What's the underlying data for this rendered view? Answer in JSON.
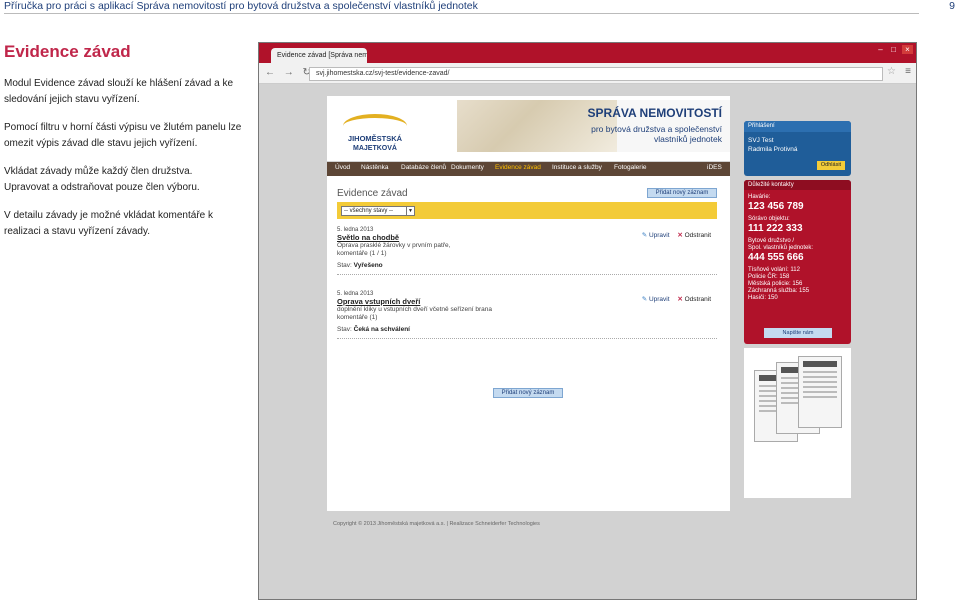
{
  "doc_header": {
    "title": "Příručka pro práci s aplikací Správa nemovitostí pro bytová družstva a společenství vlastníků jednotek",
    "page_number": "9"
  },
  "left": {
    "heading": "Evidence závad",
    "p1": "Modul Evidence závad slouží ke hlášení závad a ke sledování jejich stavu vyřízení.",
    "p2": "Pomocí filtru v horní části výpisu ve žlutém panelu lze omezit výpis závad dle stavu jejich vyřízení.",
    "p3a": "Vkládat závady může každý člen družstva.",
    "p3b": "Upravovat a odstraňovat pouze člen výboru.",
    "p4": "V detailu závady je možné vkládat komentáře k realizaci a stavu vyřízení závady."
  },
  "browser": {
    "tab_title": "Evidence závad [Správa nem",
    "url": "svj.jihomestska.cz/svj-test/evidence-zavad/"
  },
  "site": {
    "logo_line1": "JIHOMĚSTSKÁ",
    "logo_line2": "MAJETKOVÁ",
    "banner_title": "SPRÁVA NEMOVITOSTÍ",
    "banner_line2": "pro bytová družstva a společenství",
    "banner_line3": "vlastníků jednotek",
    "nav": [
      "Úvod",
      "Nástěnka",
      "Databáze členů",
      "Dokumenty",
      "Evidence závad",
      "Instituce a služby",
      "Fotogalerie",
      "iDES"
    ],
    "page_title": "Evidence závad",
    "add_new_label": "Přidat nový záznam",
    "filter_value": "-- všechny stavy --",
    "items": [
      {
        "date": "5. ledna 2013",
        "title": "Světlo na chodbě",
        "desc": "Oprava prasklé žárovky v prvním patře,",
        "comments": "komentáře (1 / 1)",
        "state_label": "Stav:",
        "state": "Vyřešeno"
      },
      {
        "date": "5. ledna 2013",
        "title": "Oprava vstupních dveří",
        "desc": "doplnění kliky u vstupních dveří včetně seřízení brana",
        "comments": "komentáře (1)",
        "state_label": "Stav:",
        "state": "Čeká na schválení"
      }
    ],
    "edit_label": "Upravit",
    "delete_label": "Odstranit",
    "footer": "Copyright © 2013 Jihoměstská majetková a.s.  |  Realizace Schneiderfer Technologies",
    "login": {
      "heading": "Přihlášení",
      "user": "SVJ Test",
      "name": "Radmila Protivná",
      "logout": "Odhlásit"
    },
    "contacts": {
      "heading": "Důležité kontakty",
      "havarie_label": "Havárie:",
      "havarie": "123 456 789",
      "sorava_label": "Sórávo objektu:",
      "sorava": "111 222 333",
      "byt_label1": "Bytové družstvo /",
      "byt_label2": "Spol. vlastníků jednotek:",
      "byt": "444 555 666",
      "l1": "Tísňové volání: 112",
      "l2": "Policie ČR: 158",
      "l3": "Městská policie: 156",
      "l4": "Záchranná služba: 155",
      "l5": "Hasiči: 150",
      "write_us": "Napište nám"
    }
  }
}
